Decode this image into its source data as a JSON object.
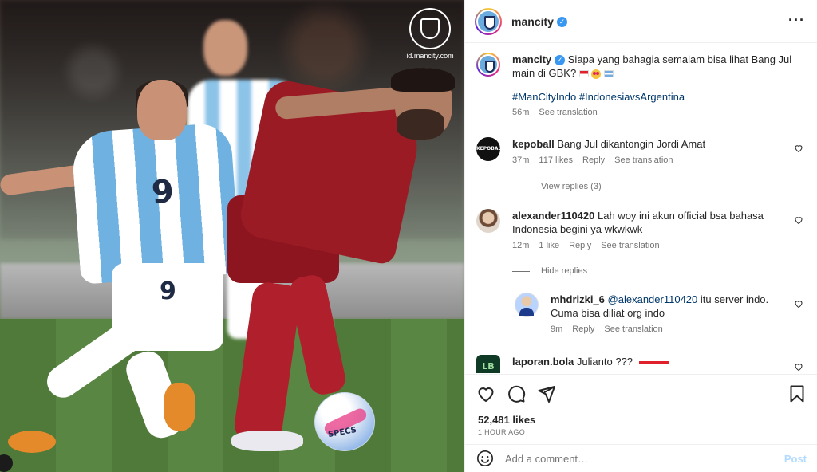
{
  "photo": {
    "watermark_url": "id.mancity.com",
    "watermark_crest_text": "MANCHESTER CITY",
    "shirt_number_front": "9",
    "shorts_number": "9",
    "ball_brand": "SPECS"
  },
  "header": {
    "username": "mancity",
    "verified": true,
    "more_icon": "more-horizontal-icon"
  },
  "caption": {
    "username": "mancity",
    "text": "Siapa yang bahagia semalam bisa lihat Bang Jul main di GBK?",
    "hashtags": "#ManCityIndo #IndonesiavsArgentina",
    "time": "56m",
    "see_translation": "See translation"
  },
  "comments": [
    {
      "username": "kepoball",
      "text": "Bang Jul dikantongin Jordi Amat",
      "time": "37m",
      "likes": "117 likes",
      "reply": "Reply",
      "see_translation": "See translation",
      "avatar_text": "KEPOBALL",
      "replies_toggle": "View replies (3)"
    },
    {
      "username": "alexander110420",
      "text": "Lah woy ini akun official bsa bahasa Indonesia begini ya wkwkwk",
      "time": "12m",
      "likes": "1 like",
      "reply": "Reply",
      "see_translation": "See translation",
      "replies_toggle": "Hide replies",
      "replies": [
        {
          "username": "mhdrizki_6",
          "mention": "@alexander110420",
          "text": "itu server indo. Cuma bisa diliat org indo",
          "time": "9m",
          "reply": "Reply",
          "see_translation": "See translation"
        }
      ]
    },
    {
      "username": "laporan.bola",
      "text": "Julianto ???",
      "avatar_text": "LB"
    }
  ],
  "actions": {
    "like_icon": "heart-icon",
    "comment_icon": "comment-icon",
    "share_icon": "share-icon",
    "save_icon": "bookmark-icon",
    "likes": "52,481 likes",
    "time_ago": "1 HOUR AGO"
  },
  "add_comment": {
    "placeholder": "Add a comment…",
    "post_label": "Post"
  }
}
